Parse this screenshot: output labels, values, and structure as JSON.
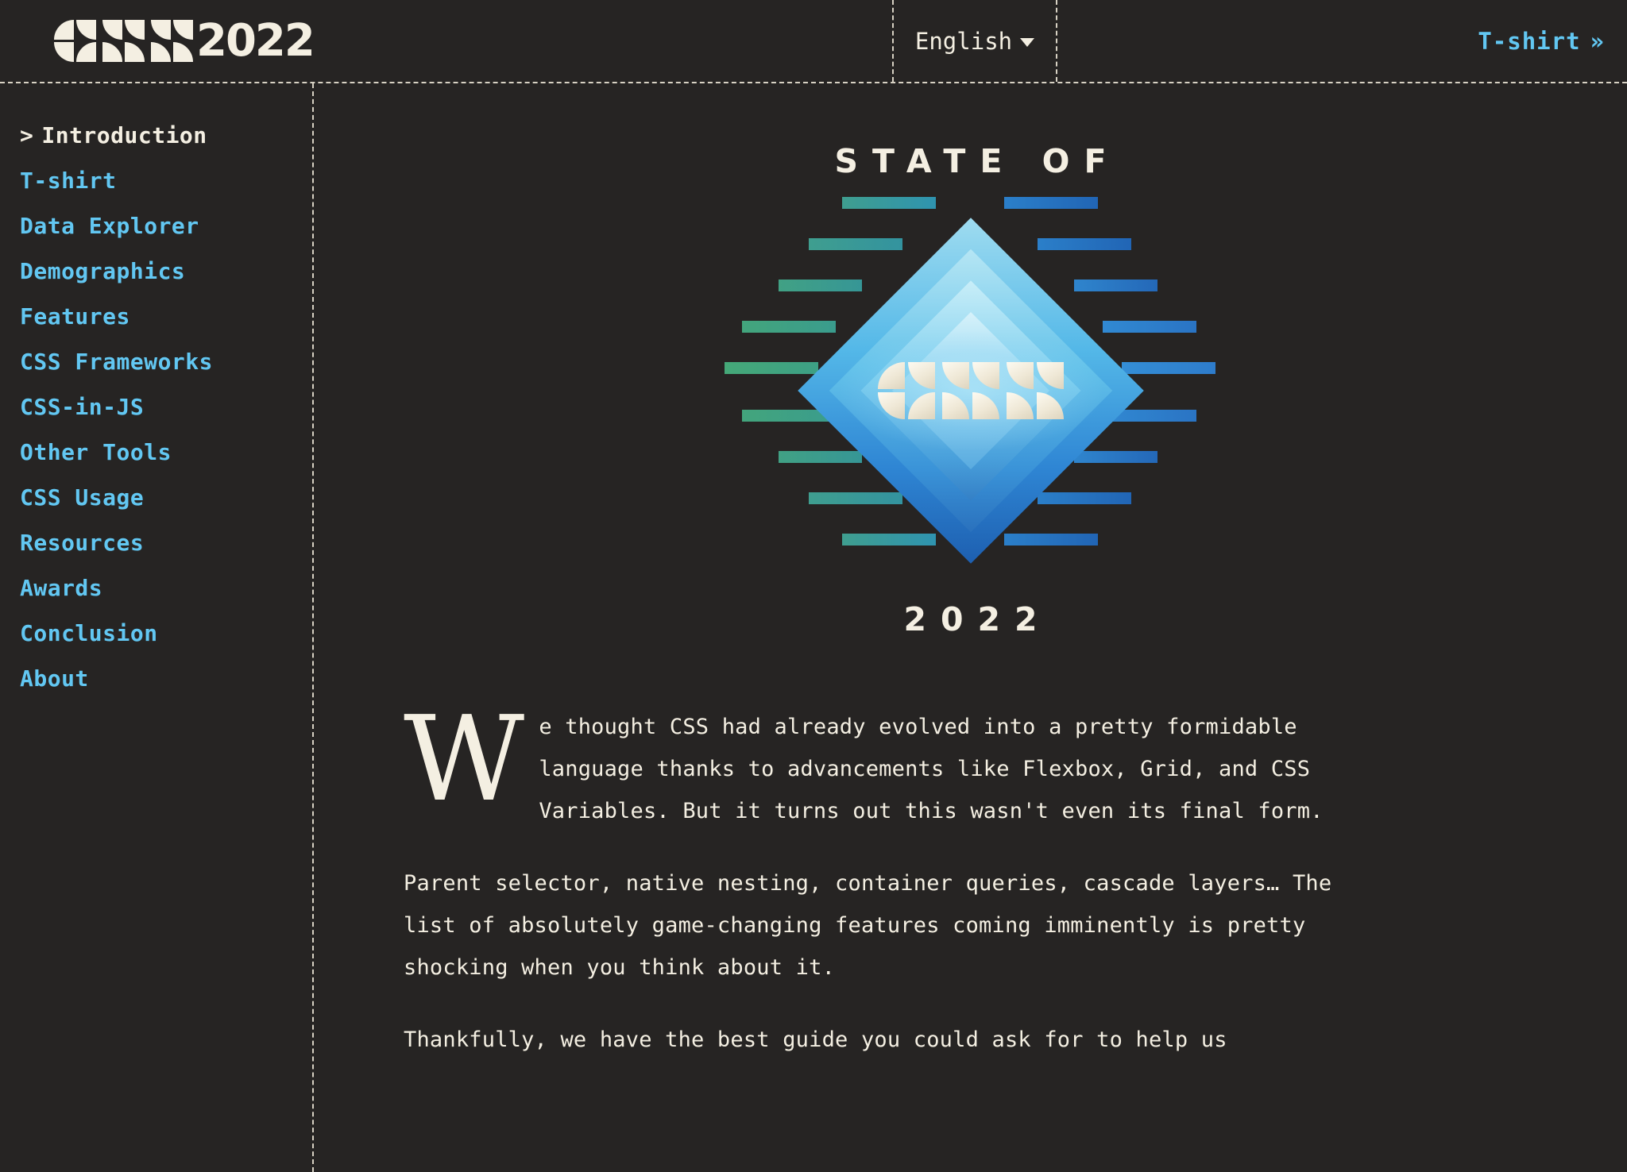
{
  "colors": {
    "background": "#262423",
    "text": "#f4efe2",
    "link": "#62c7f2",
    "dashed_rule": "#d8d2c4"
  },
  "header": {
    "logo_year": "2022",
    "logo_mark_name": "css-logo-mark",
    "language": {
      "label": "English",
      "caret": "chevron-down-icon"
    },
    "next_link": {
      "label": "T-shirt",
      "arrow": "»"
    }
  },
  "sidebar": {
    "items": [
      {
        "label": "Introduction",
        "active": true,
        "chevron": ">"
      },
      {
        "label": "T-shirt",
        "active": false
      },
      {
        "label": "Data Explorer",
        "active": false
      },
      {
        "label": "Demographics",
        "active": false
      },
      {
        "label": "Features",
        "active": false
      },
      {
        "label": "CSS Frameworks",
        "active": false
      },
      {
        "label": "CSS-in-JS",
        "active": false
      },
      {
        "label": "Other Tools",
        "active": false
      },
      {
        "label": "CSS Usage",
        "active": false
      },
      {
        "label": "Resources",
        "active": false
      },
      {
        "label": "Awards",
        "active": false
      },
      {
        "label": "Conclusion",
        "active": false
      },
      {
        "label": "About",
        "active": false
      }
    ]
  },
  "hero": {
    "top_text": "STATE OF",
    "year_text": "2022",
    "art_name": "state-of-css-diamond-logo"
  },
  "article": {
    "drop_cap": "W",
    "lead_paragraph": "e thought CSS had already evolved into a pretty formidable language thanks to advancements like Flexbox, Grid, and CSS Variables. But it turns out this wasn't even its final form.",
    "paragraph_2": "Parent selector, native nesting, container queries, cascade layers… The list of absolutely game-changing features coming imminently is pretty shocking when you think about it.",
    "paragraph_3": "Thankfully, we have the best guide you could ask for to help us"
  }
}
